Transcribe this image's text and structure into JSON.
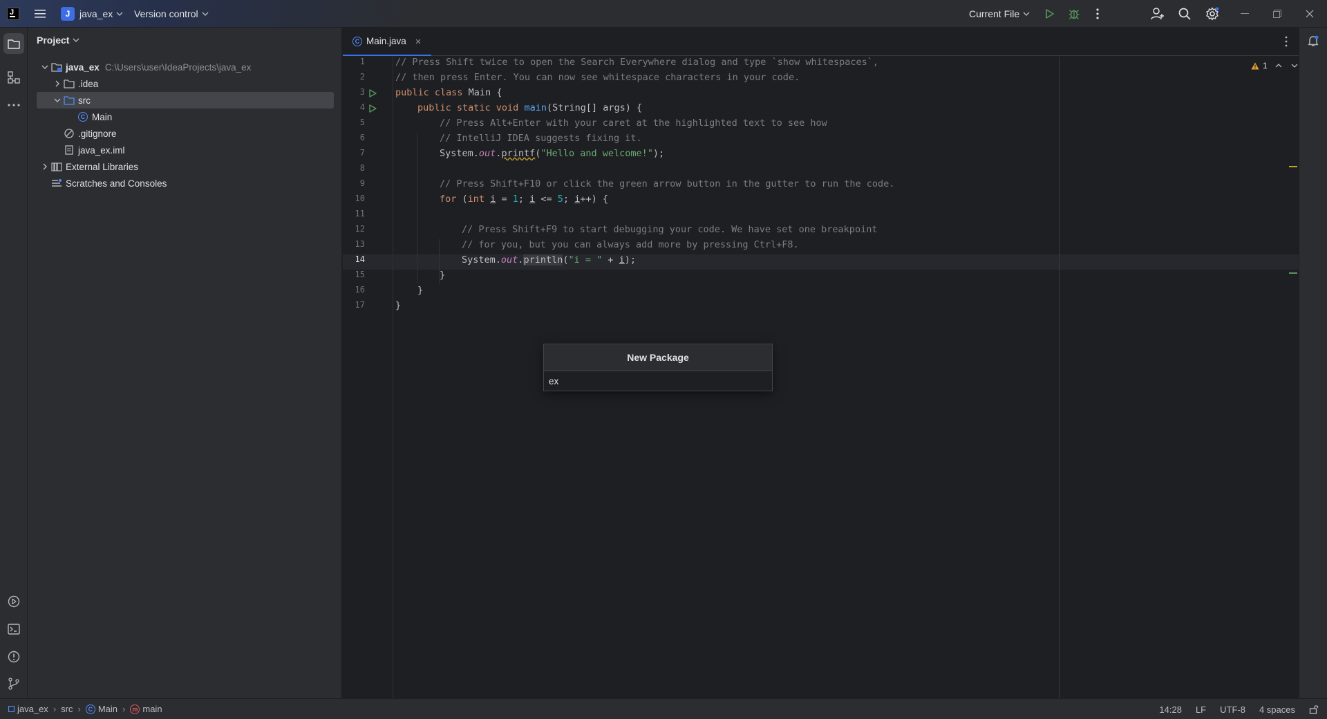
{
  "titlebar": {
    "app_icon": "intellij-logo-icon",
    "project_badge": "J",
    "project_name": "java_ex",
    "vcs_label": "Version control",
    "run_config": "Current File"
  },
  "project_panel": {
    "title": "Project",
    "tree": [
      {
        "label": "java_ex",
        "path": "C:\\Users\\user\\IdeaProjects\\java_ex",
        "icon": "module-folder-icon"
      },
      {
        "label": ".idea",
        "icon": "folder-icon"
      },
      {
        "label": "src",
        "icon": "source-folder-icon"
      },
      {
        "label": "Main",
        "icon": "java-class-icon"
      },
      {
        "label": ".gitignore",
        "icon": "ignore-file-icon"
      },
      {
        "label": "java_ex.iml",
        "icon": "iml-file-icon"
      },
      {
        "label": "External Libraries",
        "icon": "libraries-icon"
      },
      {
        "label": "Scratches and Consoles",
        "icon": "scratches-icon"
      }
    ]
  },
  "editor": {
    "tab_label": "Main.java",
    "warning_count": "1",
    "line_numbers": [
      "1",
      "2",
      "3",
      "4",
      "5",
      "6",
      "7",
      "8",
      "9",
      "10",
      "11",
      "12",
      "13",
      "14",
      "15",
      "16",
      "17"
    ],
    "current_line": "14",
    "code": {
      "l1": "// Press Shift twice to open the Search Everywhere dialog and type `show whitespaces`,",
      "l2": "// then press Enter. You can now see whitespace characters in your code.",
      "l3_kw": "public class",
      "l3_rest": " Main {",
      "l4_kw": "public static void",
      "l4_fn": "main",
      "l4_rest": "(String[] args) {",
      "l5": "// Press Alt+Enter with your caret at the highlighted text to see how",
      "l6": "// IntelliJ IDEA suggests fixing it.",
      "l7_a": "System.",
      "l7_out": "out",
      "l7_b": ".",
      "l7_fn": "printf",
      "l7_c": "(",
      "l7_str": "\"Hello and welcome!\"",
      "l7_d": ");",
      "l9": "// Press Shift+F10 or click the green arrow button in the gutter to run the code.",
      "l10_for": "for",
      "l10_a": " (",
      "l10_int": "int",
      "l10_i1": "i",
      "l10_b": " = ",
      "l10_n1": "1",
      "l10_c": "; ",
      "l10_i2": "i",
      "l10_d": " <= ",
      "l10_n2": "5",
      "l10_e": "; ",
      "l10_i3": "i",
      "l10_f": "++) {",
      "l12": "// Press Shift+F9 to start debugging your code. We have set one breakpoint",
      "l13": "// for you, but you can always add more by pressing Ctrl+F8.",
      "l14_a": "System.",
      "l14_out": "out",
      "l14_b": ".",
      "l14_fn": "println",
      "l14_c": "(",
      "l14_str": "\"i = \"",
      "l14_d": " + ",
      "l14_i": "i",
      "l14_e": ");",
      "l15": "}",
      "l16": "}",
      "l17": "}"
    }
  },
  "popup": {
    "title": "New Package",
    "value": "ex"
  },
  "statusbar": {
    "breadcrumbs": [
      "java_ex",
      "src",
      "Main",
      "main"
    ],
    "position": "14:28",
    "line_sep": "LF",
    "encoding": "UTF-8",
    "indent": "4 spaces"
  },
  "colors": {
    "accent": "#3574f0",
    "run_green": "#57965c",
    "warning": "#e0a030",
    "background": "#1e1f22",
    "panel": "#2b2d30"
  }
}
